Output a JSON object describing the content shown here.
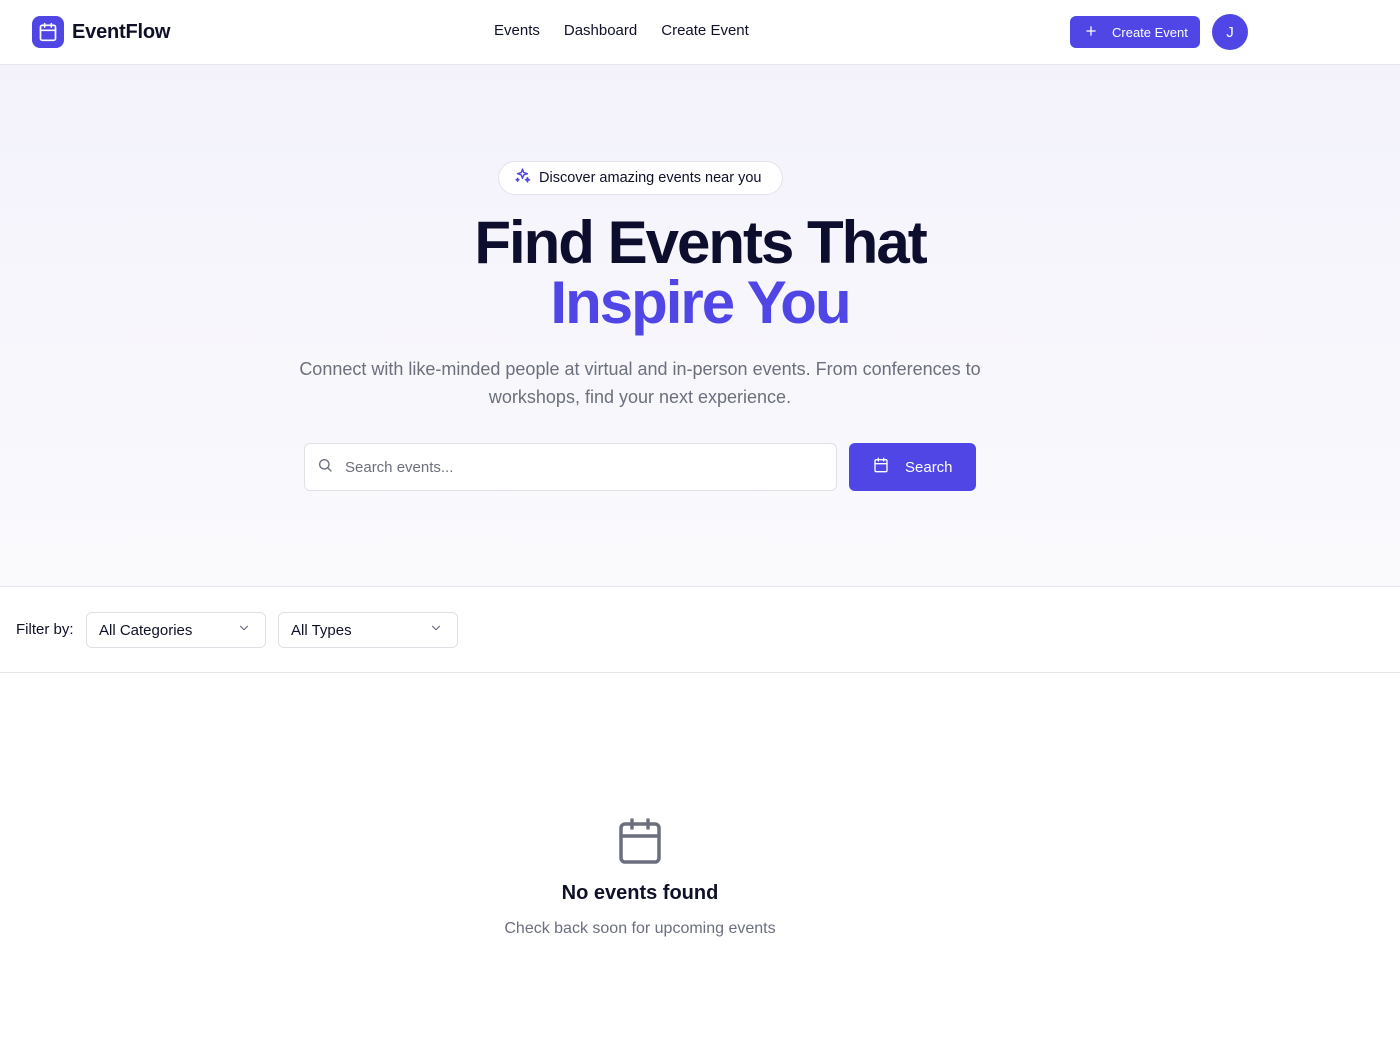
{
  "header": {
    "brand_name": "EventFlow",
    "nav": [
      "Events",
      "Dashboard",
      "Create Event"
    ],
    "create_button_label": "Create Event",
    "avatar_initial": "J"
  },
  "hero": {
    "pill_text": "Discover amazing events near you",
    "title_line1": "Find Events That",
    "title_line2": "Inspire You",
    "subtitle": "Connect with like-minded people at virtual and in-person events. From conferences to workshops, find your next experience.",
    "search_placeholder": "Search events...",
    "search_button_label": "Search"
  },
  "filters": {
    "label": "Filter by:",
    "category_selected": "All Categories",
    "type_selected": "All Types"
  },
  "empty_state": {
    "title": "No events found",
    "subtitle": "Check back soon for upcoming events"
  },
  "colors": {
    "accent": "#4f46e5",
    "text": "#0f1129",
    "muted": "#6b6f7e",
    "border": "#e6e7eb"
  },
  "icons": [
    "calendar-icon",
    "plus-icon",
    "sparkles-icon",
    "search-icon",
    "chevron-down-icon"
  ]
}
